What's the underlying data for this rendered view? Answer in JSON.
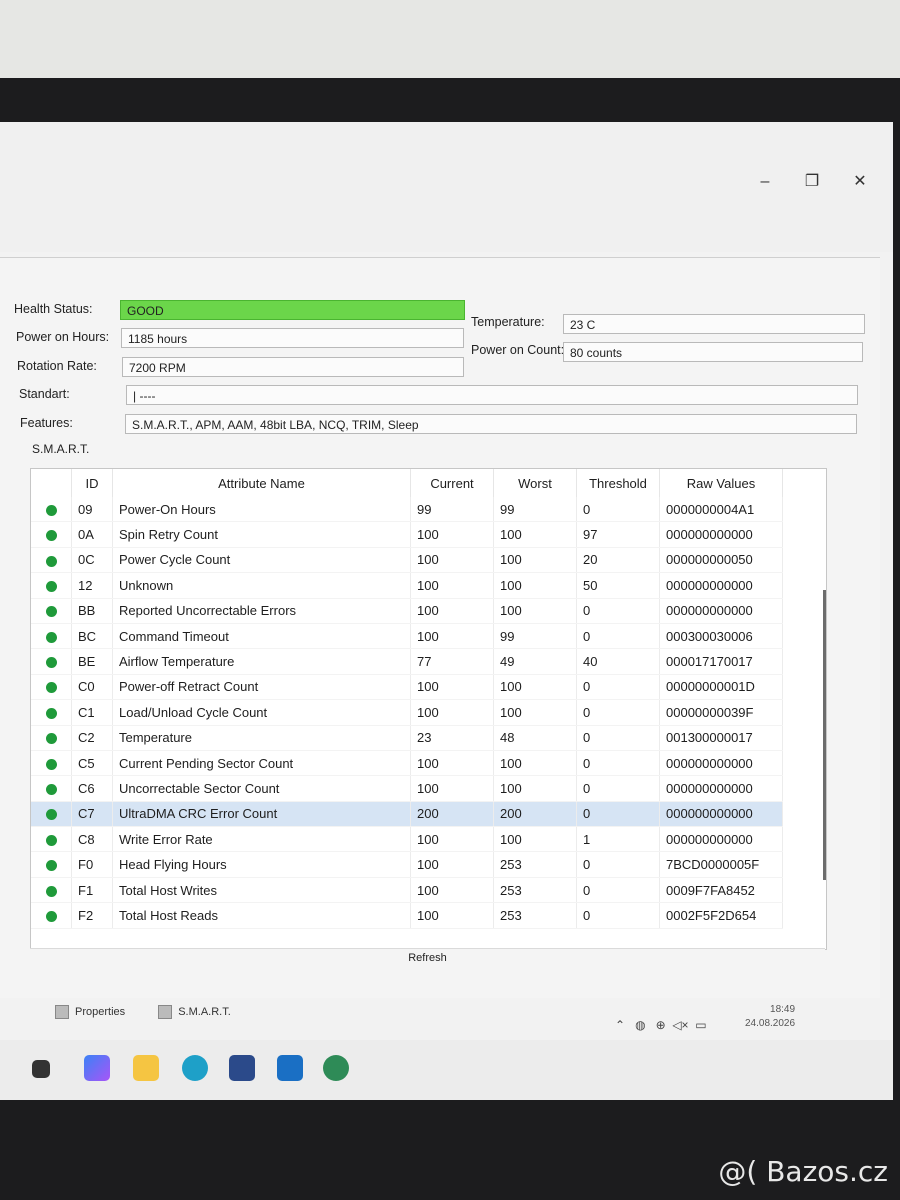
{
  "window": {
    "min_glyph": "–",
    "restore_glyph": "❐",
    "close_glyph": "✕"
  },
  "info": {
    "health_label": "Health Status:",
    "health_value": "GOOD",
    "poh_label": "Power on Hours:",
    "poh_value": "1185 hours",
    "rotation_label": "Rotation Rate:",
    "rotation_value": "7200 RPM",
    "standart_label": "Standart:",
    "standart_value": "| ----",
    "features_label": "Features:",
    "features_value": "S.M.A.R.T., APM, AAM, 48bit LBA, NCQ, TRIM, Sleep",
    "temp_label": "Temperature:",
    "temp_value": "23 C",
    "poc_label": "Power on Count:",
    "poc_value": "80 counts",
    "good_color": "#6bd64a"
  },
  "smart": {
    "section_label": "S.M.A.R.T.",
    "headers": [
      "ID",
      "Attribute Name",
      "Current",
      "Worst",
      "Threshold",
      "Raw Values"
    ],
    "rows": [
      [
        "09",
        "Power-On Hours",
        "99",
        "99",
        "0",
        "0000000004A1"
      ],
      [
        "0A",
        "Spin Retry Count",
        "100",
        "100",
        "97",
        "000000000000"
      ],
      [
        "0C",
        "Power Cycle Count",
        "100",
        "100",
        "20",
        "000000000050"
      ],
      [
        "12",
        "Unknown",
        "100",
        "100",
        "50",
        "000000000000"
      ],
      [
        "BB",
        "Reported Uncorrectable Errors",
        "100",
        "100",
        "0",
        "000000000000"
      ],
      [
        "BC",
        "Command Timeout",
        "100",
        "99",
        "0",
        "000300030006"
      ],
      [
        "BE",
        "Airflow Temperature",
        "77",
        "49",
        "40",
        "000017170017"
      ],
      [
        "C0",
        "Power-off Retract Count",
        "100",
        "100",
        "0",
        "00000000001D"
      ],
      [
        "C1",
        "Load/Unload Cycle Count",
        "100",
        "100",
        "0",
        "00000000039F"
      ],
      [
        "C2",
        "Temperature",
        "23",
        "48",
        "0",
        "001300000017"
      ],
      [
        "C5",
        "Current Pending Sector Count",
        "100",
        "100",
        "0",
        "000000000000"
      ],
      [
        "C6",
        "Uncorrectable Sector Count",
        "100",
        "100",
        "0",
        "000000000000"
      ],
      [
        "C7",
        "UltraDMA CRC Error Count",
        "200",
        "200",
        "0",
        "000000000000"
      ],
      [
        "C8",
        "Write Error Rate",
        "100",
        "100",
        "1",
        "000000000000"
      ],
      [
        "F0",
        "Head Flying Hours",
        "100",
        "253",
        "0",
        "7BCD0000005F"
      ],
      [
        "F1",
        "Total Host Writes",
        "100",
        "253",
        "0",
        "0009F7FA8452"
      ],
      [
        "F2",
        "Total Host Reads",
        "100",
        "253",
        "0",
        "0002F5F2D654"
      ]
    ],
    "highlighted_row": 12,
    "status_color": "#1f9a3a",
    "refresh_label": "Refresh"
  },
  "tabs": {
    "properties": "Properties",
    "smart": "S.M.A.R.T."
  },
  "clock": {
    "time": "18:49",
    "date": "24.08.2026"
  },
  "watermark": "@( Bazos.cz"
}
